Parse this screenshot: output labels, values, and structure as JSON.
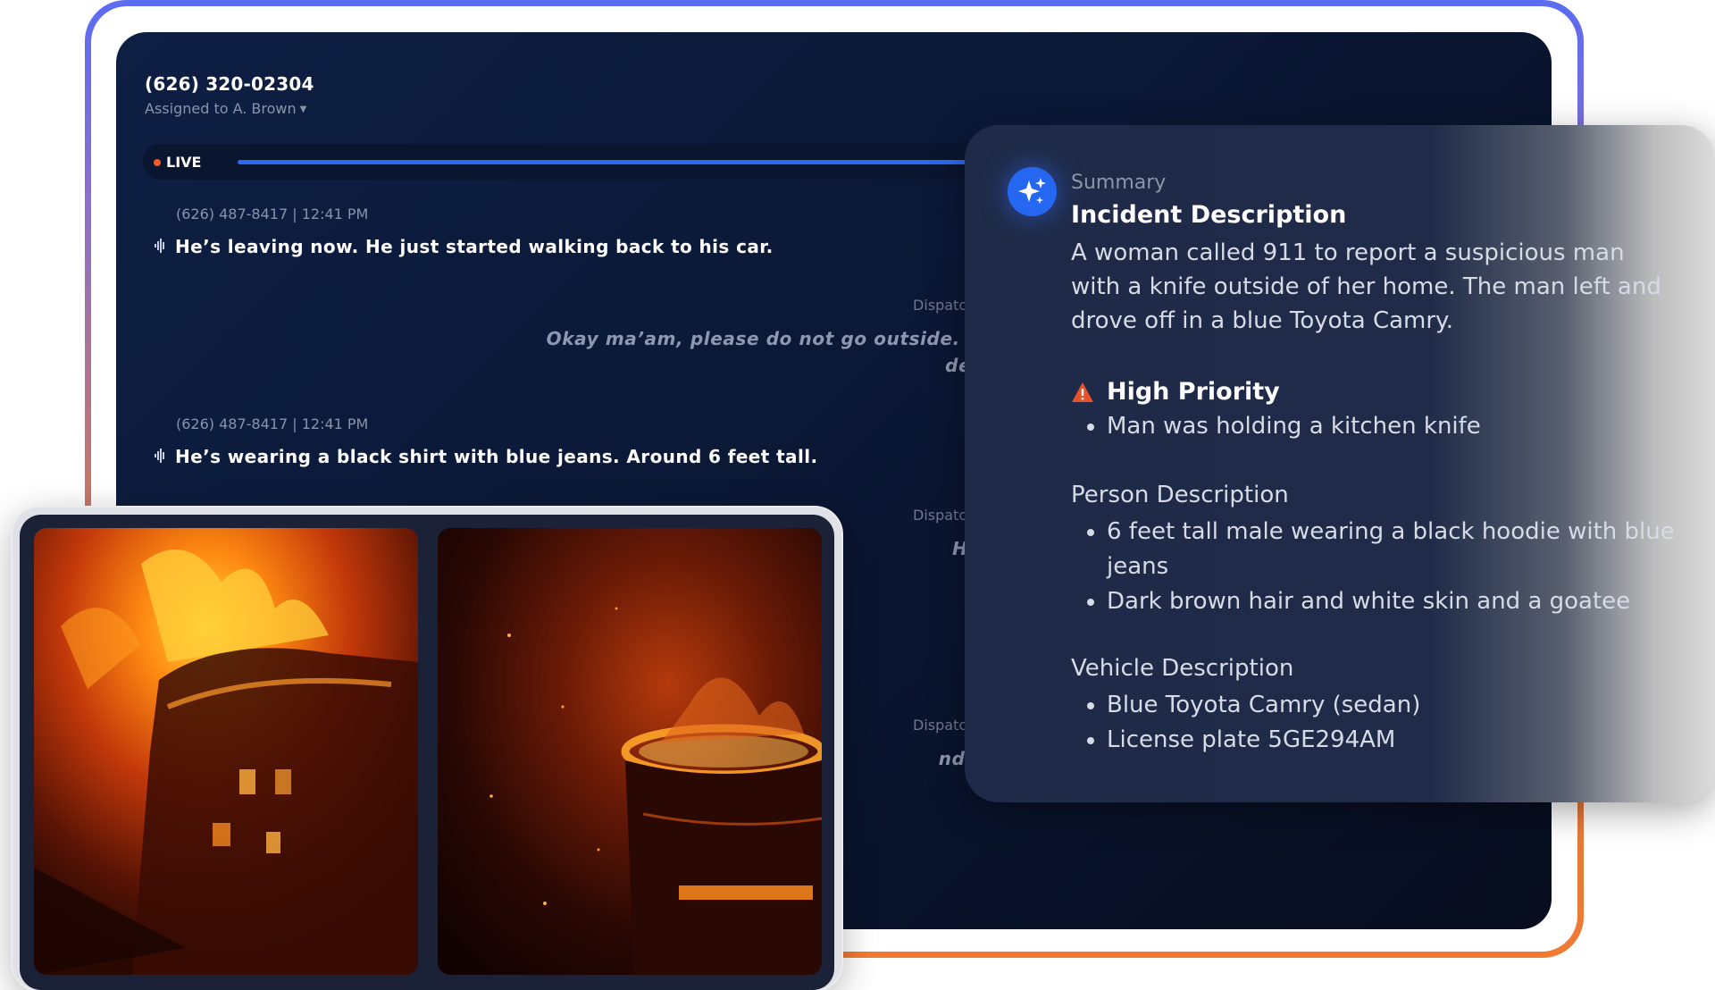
{
  "call": {
    "number": "(626) 320-02304",
    "assigned": "Assigned to A. Brown",
    "live_label": "LIVE"
  },
  "messages": [
    {
      "meta": "(626) 487-8417 | 12:41 PM",
      "text": "He’s leaving now. He just started walking back to his car."
    },
    {
      "meta": "(626) 487-8417 | 12:41 PM",
      "text": "He’s wearing a black shirt with blue jeans. Around 6 feet tall."
    }
  ],
  "dispatch": [
    {
      "meta": "Dispatc",
      "line1": "Okay ma’am, please do not go outside. Can you",
      "line2": "descriptio"
    },
    {
      "meta": "Dispatc",
      "line1": "Hair and s"
    },
    {
      "meta": "Dispatc",
      "line1": "nd what abou"
    }
  ],
  "summary": {
    "label": "Summary",
    "incident_title": "Incident Description",
    "incident_text": "A woman called 911 to report a suspicious man with a knife outside of her home. The man left and drove off in a blue Toyota Camry.",
    "priority_title": "High Priority",
    "priority_items": [
      "Man was holding a kitchen knife"
    ],
    "person_title": "Person Description",
    "person_items": [
      "6 feet tall male wearing a black hoodie with blue jeans",
      "Dark brown hair and white skin and a goatee"
    ],
    "vehicle_title": "Vehicle Description",
    "vehicle_items": [
      "Blue Toyota Camry (sedan)",
      "License plate 5GE294AM"
    ]
  },
  "photos": [
    {
      "name": "building-fire-photo-1"
    },
    {
      "name": "building-fire-photo-2"
    }
  ],
  "colors": {
    "accent_blue": "#2a69f0",
    "live_dot": "#f05a2a",
    "warning": "#e8512a",
    "frame_gradient_start": "#5a6cf2",
    "frame_gradient_end": "#f07a32"
  }
}
